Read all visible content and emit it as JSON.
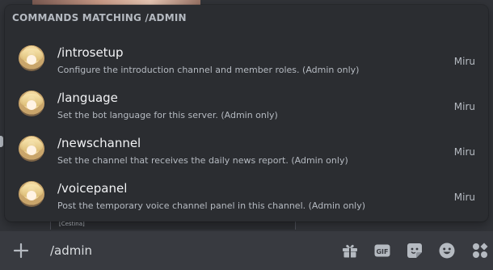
{
  "autocomplete": {
    "header": "COMMANDS MATCHING /ADMIN",
    "commands": [
      {
        "name": "/introsetup",
        "description": "Configure the introduction channel and member roles. (Admin only)",
        "source": "Miru"
      },
      {
        "name": "/language",
        "description": "Set the bot language for this server. (Admin only)",
        "source": "Miru"
      },
      {
        "name": "/newschannel",
        "description": "Set the channel that receives the daily news report. (Admin only)",
        "source": "Miru"
      },
      {
        "name": "/voicepanel",
        "description": "Post the temporary voice channel panel in this channel. (Admin only)",
        "source": "Miru"
      }
    ]
  },
  "background": {
    "embed_label": "[Čeština]"
  },
  "composer": {
    "value": "/admin",
    "icons": {
      "attach": "plus-icon",
      "gift": "gift-icon",
      "gif": "gif-icon",
      "sticker": "sticker-icon",
      "emoji": "emoji-icon",
      "apps": "apps-icon"
    },
    "gif_glyph": "GIF"
  },
  "colors": {
    "popup_bg": "#2b2d31",
    "page_bg": "#313338",
    "input_bg": "#383a40",
    "primary_text": "#f2f3f5",
    "muted_text": "#b5bac1"
  }
}
